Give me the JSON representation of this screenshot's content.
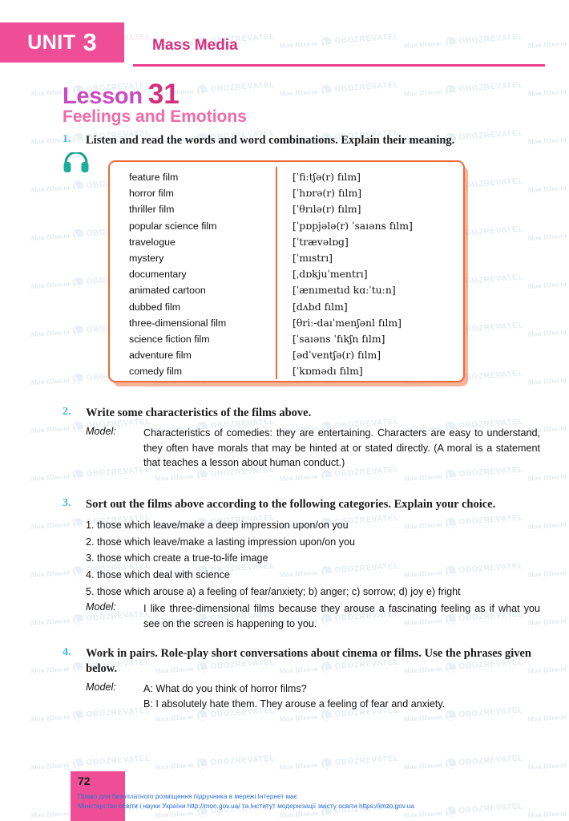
{
  "header": {
    "unit_word": "UNIT",
    "unit_number": "3",
    "unit_title": "Mass Media",
    "lesson_word": "Lesson",
    "lesson_number": "31",
    "lesson_subtitle": "Feelings and Emotions",
    "banner_color": "#ef4e96",
    "title_color": "#d62f7e",
    "subtitle_color": "#f06aa8"
  },
  "exercises": [
    {
      "number": "1.",
      "title": "Listen and read the words and word combinations. Explain their meaning.",
      "icon": "headphones-icon"
    },
    {
      "number": "2.",
      "title": "Write some characteristics of the films above.",
      "model_label": "Model:",
      "model_text": "Characteristics of comedies: they are entertaining. Characters are easy to understand, they often have morals that may be hinted at or stated directly. (A moral is a statement that teaches a lesson about human conduct.)"
    },
    {
      "number": "3.",
      "title": "Sort out the films above according to the following categories. Explain your choice.",
      "items": [
        "1. those which leave/make a deep impression upon/on you",
        "2. those which leave/make a lasting impression upon/on you",
        "3. those which create a true-to-life image",
        "4. those which deal with science",
        "5. those which arouse a) a feeling of fear/anxiety; b) anger; c) sorrow; d) joy e) fright"
      ],
      "model_label": "Model:",
      "model_text": "I like three-dimensional films because they arouse a fascinating feeling as if what you see on the screen is happening to you."
    },
    {
      "number": "4.",
      "title": "Work in pairs. Role-play short conversations about cinema or films. Use the phrases given below.",
      "model_label": "Model:",
      "dialogue": [
        "A: What do you think of horror films?",
        "B: I absolutely hate them. They arouse a feeling of fear and anxiety."
      ]
    }
  ],
  "vocabulary": {
    "border_color": "#ee6a3a",
    "words": [
      "feature film",
      "horror film",
      "thriller film",
      "popular science film",
      "travelogue",
      "mystery",
      "documentary",
      "animated cartoon",
      "dubbed film",
      "three-dimensional film",
      "science fiction film",
      "adventure film",
      "comedy film"
    ],
    "transcriptions": [
      "[ˈfiːtʃə(r) fılm]",
      "[ˈhɒrə(r) fılm]",
      "[ˈθrılə(r) fılm]",
      "[ˈpɒpjələ(r) ˈsaıəns fılm]",
      "[ˈtrævəlɒg]",
      "[ˈmıstrı]",
      "[ˌdɒkjuˈmentrı]",
      "[ˈænımeıtıd kɑːˈtuːn]",
      "[dʌbd fılm]",
      "[θriː-daıˈmenʃənl fılm]",
      "[ˈsaıəns ˈfıkʃn fılm]",
      "[ədˈventʃə(r) fılm]",
      "[ˈkɒmədı fılm]"
    ]
  },
  "footer": {
    "page_number": "72",
    "line1": "Право для безоплатного розміщення підручника в мережі Інтернет має",
    "line2": "Міністерство освіти і науки України http://mon.gov.ua/ та Інститут модернізації змісту освіти https://imzo.gov.ua"
  },
  "watermark": {
    "school_text": "Моя Школа",
    "brand_text": "OBOZREVATEL"
  }
}
